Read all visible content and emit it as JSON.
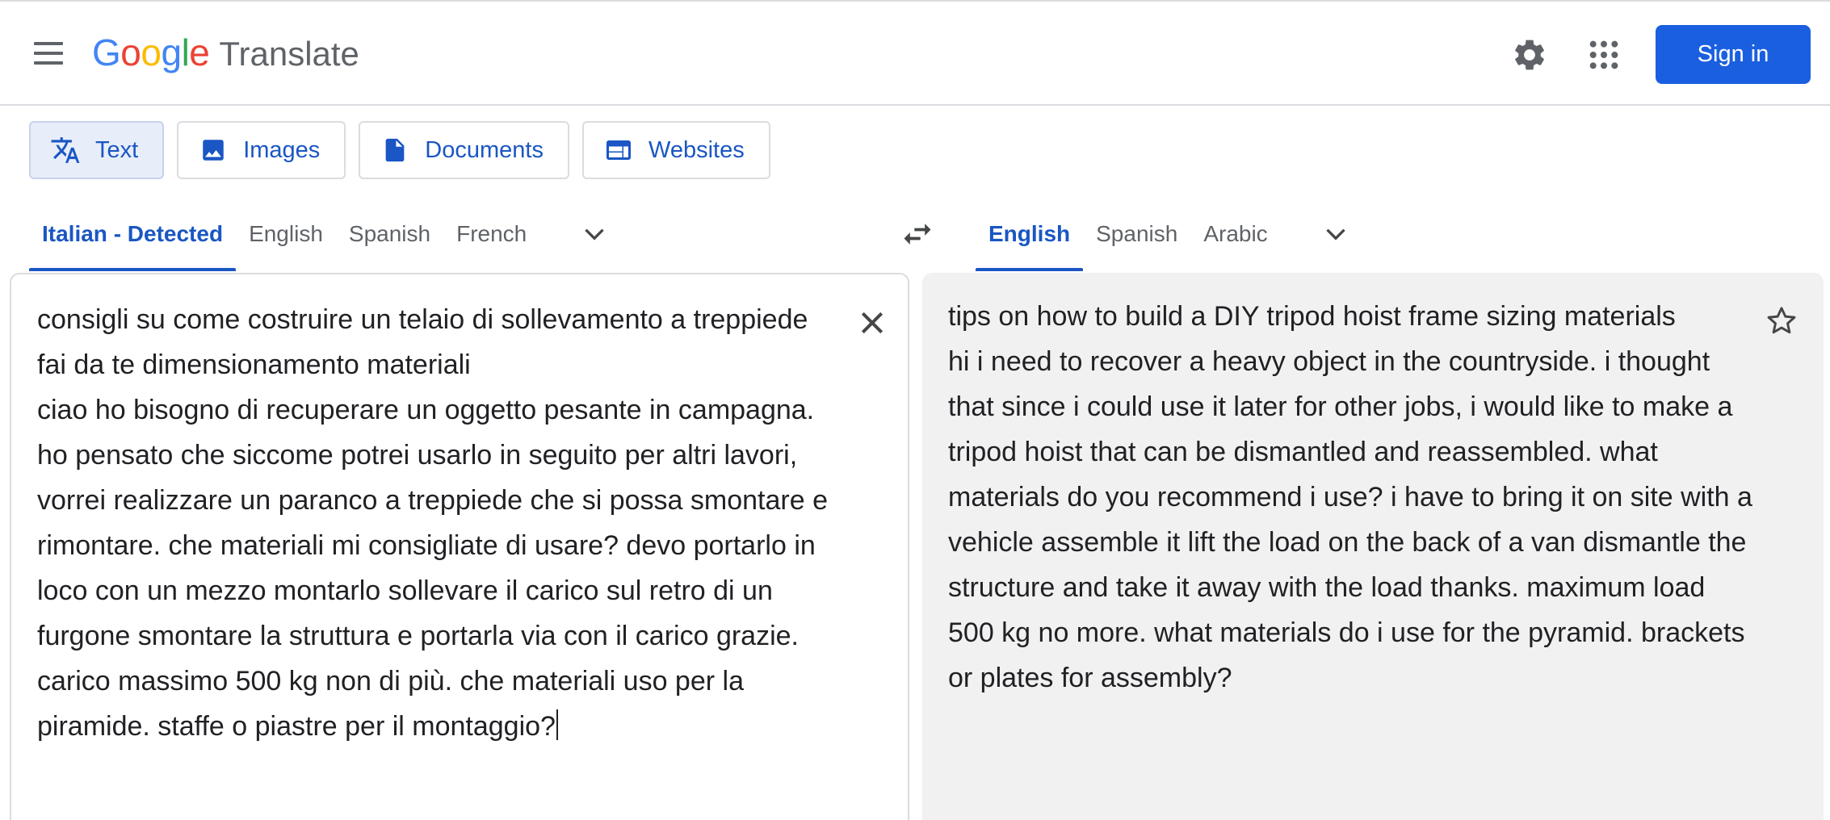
{
  "header": {
    "logo_letters": [
      "G",
      "o",
      "o",
      "g",
      "l",
      "e"
    ],
    "logo_colors": [
      "#4285f4",
      "#ea4335",
      "#fbbc05",
      "#4285f4",
      "#34a853",
      "#ea4335"
    ],
    "product": "Translate",
    "signin_label": "Sign in",
    "icons": [
      "menu-icon",
      "gear-icon",
      "apps-grid-icon"
    ]
  },
  "modes": [
    {
      "label": "Text",
      "icon": "translate-icon",
      "active": true
    },
    {
      "label": "Images",
      "icon": "image-icon",
      "active": false
    },
    {
      "label": "Documents",
      "icon": "document-icon",
      "active": false
    },
    {
      "label": "Websites",
      "icon": "website-icon",
      "active": false
    }
  ],
  "source_langs": [
    "Italian - Detected",
    "English",
    "Spanish",
    "French"
  ],
  "target_langs": [
    "English",
    "Spanish",
    "Arabic"
  ],
  "source_text": "consigli su come costruire un telaio di sollevamento a treppiede fai da te dimensionamento materiali\nciao ho bisogno di recuperare un oggetto pesante in campagna. ho pensato che siccome potrei usarlo in seguito per altri lavori, vorrei realizzare un paranco a treppiede che si possa smontare e rimontare. che materiali mi consigliate di usare? devo portarlo in loco con un mezzo montarlo sollevare il carico sul retro di un furgone smontare la struttura e portarla via con il carico grazie. carico massimo 500 kg non di più. che materiali uso per la piramide. staffe o piastre per il montaggio?",
  "translated_text": "tips on how to build a DIY tripod hoist frame sizing materials\nhi i need to recover a heavy object in the countryside. i thought that since i could use it later for other jobs, i would like to make a tripod hoist that can be dismantled and reassembled. what materials do you recommend i use? i have to bring it on site with a vehicle assemble it lift the load on the back of a van dismantle the structure and take it away with the load thanks. maximum load 500 kg no more. what materials do i use for the pyramid. brackets or plates for assembly?",
  "colors": {
    "accent": "#1a56c4",
    "signin_bg": "#1a5fe0",
    "target_bg": "#f1f1f1"
  }
}
